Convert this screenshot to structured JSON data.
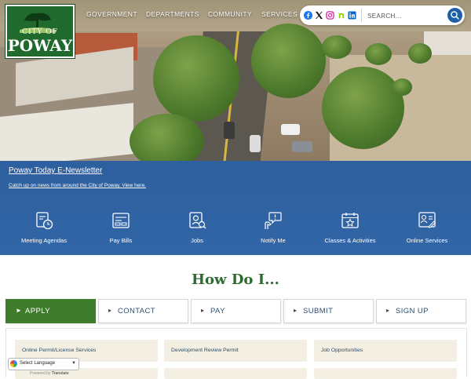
{
  "logo": {
    "line1": "CITY OF",
    "line2": "POWAY"
  },
  "nav": {
    "items": [
      "GOVERNMENT",
      "DEPARTMENTS",
      "COMMUNITY",
      "SERVICES"
    ]
  },
  "social": [
    "facebook-icon",
    "x-icon",
    "instagram-icon",
    "nextdoor-icon",
    "linkedin-icon"
  ],
  "search": {
    "placeholder": "SEARCH..."
  },
  "newsletter": {
    "title": "Poway Today E-Newsletter",
    "subtitle": "Catch up on news from around the City of Poway. View here."
  },
  "quick_links": [
    {
      "label": "Meeting Agendas",
      "icon": "agenda-clock-icon"
    },
    {
      "label": "Pay Bills",
      "icon": "bill-icon"
    },
    {
      "label": "Jobs",
      "icon": "jobs-icon"
    },
    {
      "label": "Notify Me",
      "icon": "notify-hand-icon"
    },
    {
      "label": "Classes & Activities",
      "icon": "calendar-star-icon"
    },
    {
      "label": "Online Services",
      "icon": "online-form-icon"
    }
  ],
  "howdo": {
    "title": "How Do I...",
    "tabs": [
      "APPLY",
      "CONTACT",
      "PAY",
      "SUBMIT",
      "SIGN UP"
    ],
    "active_tab": "APPLY",
    "cards": [
      "Online Permit/License Services",
      "Development Review Permit",
      "Job Opportunities"
    ]
  },
  "translate": {
    "label": "Select Language",
    "powered": "Powered by",
    "brand": "Translate"
  },
  "colors": {
    "band": "#3266a6",
    "accent_green": "#3f7d2c",
    "heading_green": "#2e6b30",
    "card_bg": "#f3efe2"
  }
}
